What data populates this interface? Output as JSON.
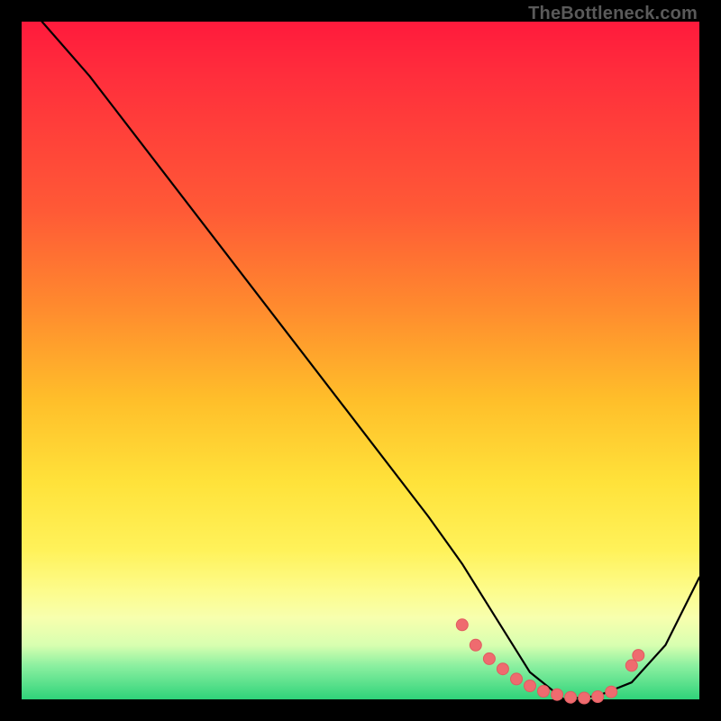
{
  "watermark": "TheBottleneck.com",
  "colors": {
    "curve_stroke": "#000000",
    "marker_fill": "#ef6b6f",
    "marker_stroke": "#e05c60"
  },
  "chart_data": {
    "type": "line",
    "title": "",
    "xlabel": "",
    "ylabel": "",
    "xlim": [
      0,
      100
    ],
    "ylim": [
      0,
      100
    ],
    "grid": false,
    "legend": false,
    "series": [
      {
        "name": "curve",
        "x": [
          3,
          10,
          20,
          30,
          40,
          50,
          60,
          65,
          70,
          75,
          80,
          85,
          90,
          95,
          100
        ],
        "values": [
          100,
          92,
          79,
          66,
          53,
          40,
          27,
          20,
          12,
          4,
          0,
          0.5,
          2.5,
          8,
          18
        ]
      }
    ],
    "markers": {
      "x": [
        65,
        67,
        69,
        71,
        73,
        75,
        77,
        79,
        81,
        83,
        85,
        87,
        90,
        91
      ],
      "values": [
        11,
        8,
        6,
        4.5,
        3,
        2,
        1.2,
        0.7,
        0.3,
        0.2,
        0.4,
        1.1,
        5,
        6.5
      ]
    }
  }
}
